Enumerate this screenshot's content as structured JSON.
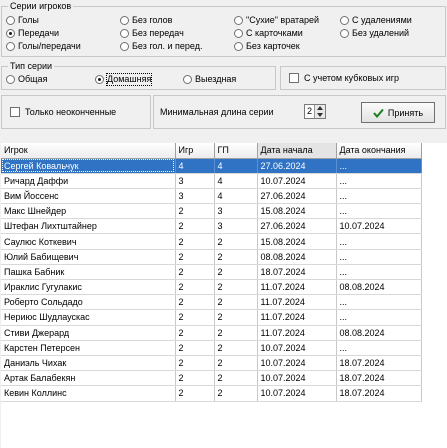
{
  "series_group": {
    "title": "Серии игроков",
    "options": [
      {
        "label": "Голы",
        "selected": false
      },
      {
        "label": "Без голов",
        "selected": false
      },
      {
        "label": "\"Сухие\" вратарей",
        "selected": false
      },
      {
        "label": "С удалениями",
        "selected": false
      },
      {
        "label": "Передачи",
        "selected": true
      },
      {
        "label": "Без передач",
        "selected": false
      },
      {
        "label": "С карточками",
        "selected": false
      },
      {
        "label": "Без удалений",
        "selected": false
      },
      {
        "label": "Голы/передачи",
        "selected": false
      },
      {
        "label": "Без гол. и перед.",
        "selected": false
      },
      {
        "label": "Без карточек",
        "selected": false
      }
    ]
  },
  "series_type": {
    "title": "Тип серии",
    "options": [
      {
        "label": "Общая",
        "selected": false
      },
      {
        "label": "Домашняя",
        "selected": true
      },
      {
        "label": "Выездная",
        "selected": false
      }
    ]
  },
  "cup_games_checkbox": {
    "label": "С учетом кубковых игр",
    "checked": false
  },
  "unfinished_checkbox": {
    "label": "Только неоконченные",
    "checked": false
  },
  "min_length": {
    "label": "Минимальная длина серии",
    "value": "2"
  },
  "accept_button": {
    "label": "Принять"
  },
  "table": {
    "columns": [
      "Игрок",
      "Игр",
      "ГП",
      "Дата начала",
      "Дата окончания"
    ],
    "rows": [
      [
        "Сергей Ковальчук",
        "4",
        "4",
        "27.06.2024",
        "..."
      ],
      [
        "Ричард Даффи",
        "3",
        "4",
        "10.07.2024",
        "..."
      ],
      [
        "Вим Йоссенс",
        "3",
        "4",
        "27.06.2024",
        "..."
      ],
      [
        "Макс Шнейдер",
        "2",
        "3",
        "15.08.2024",
        "..."
      ],
      [
        "Штефан Лихтштайнер",
        "2",
        "3",
        "27.06.2024",
        "10.07.2024"
      ],
      [
        "Саулюс Коткевич",
        "2",
        "2",
        "15.08.2024",
        "..."
      ],
      [
        "Юлий Бабищевич",
        "2",
        "2",
        "08.08.2024",
        "..."
      ],
      [
        "Пашка Бабник",
        "2",
        "2",
        "18.07.2024",
        "..."
      ],
      [
        "Ираклис Гугулакис",
        "2",
        "2",
        "11.07.2024",
        "08.08.2024"
      ],
      [
        "Роберто Сольдадо",
        "2",
        "2",
        "11.07.2024",
        "..."
      ],
      [
        "Нериюс Шудлаускас",
        "2",
        "2",
        "11.07.2024",
        "..."
      ],
      [
        "Стиви Джерард",
        "2",
        "2",
        "11.07.2024",
        "08.08.2024"
      ],
      [
        "Карстен Петерсен",
        "2",
        "2",
        "10.07.2024",
        "..."
      ],
      [
        "Даниэль Чихак",
        "2",
        "2",
        "10.07.2024",
        "18.07.2024"
      ],
      [
        "Артак Балабекян",
        "2",
        "2",
        "10.07.2024",
        "18.07.2024"
      ],
      [
        "Кевин Коллинс",
        "2",
        "2",
        "10.07.2024",
        "18.07.2024"
      ]
    ],
    "selected_row": 0
  },
  "colors": {
    "selection": "#3072c4",
    "panel": "#f0f0f0"
  }
}
